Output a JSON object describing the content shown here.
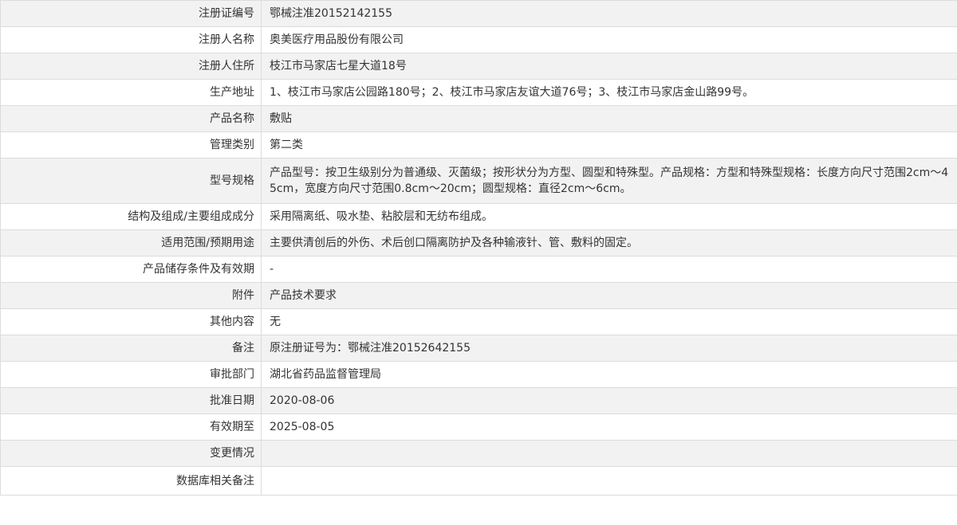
{
  "rows": [
    {
      "label": "注册证编号",
      "value": "鄂械注准20152142155"
    },
    {
      "label": "注册人名称",
      "value": "奥美医疗用品股份有限公司"
    },
    {
      "label": "注册人住所",
      "value": "枝江市马家店七星大道18号"
    },
    {
      "label": "生产地址",
      "value": "1、枝江市马家店公园路180号；2、枝江市马家店友谊大道76号；3、枝江市马家店金山路99号。"
    },
    {
      "label": "产品名称",
      "value": "敷贴"
    },
    {
      "label": "管理类别",
      "value": "第二类"
    },
    {
      "label": "型号规格",
      "value": "产品型号：按卫生级别分为普通级、灭菌级；按形状分为方型、圆型和特殊型。产品规格：方型和特殊型规格：长度方向尺寸范围2cm～45cm，宽度方向尺寸范围0.8cm～20cm；圆型规格：直径2cm～6cm。"
    },
    {
      "label": "结构及组成/主要组成成分",
      "value": "采用隔离纸、吸水垫、粘胶层和无纺布组成。"
    },
    {
      "label": "适用范围/预期用途",
      "value": "主要供清创后的外伤、术后创口隔离防护及各种输液针、管、敷料的固定。"
    },
    {
      "label": "产品储存条件及有效期",
      "value": "-"
    },
    {
      "label": "附件",
      "value": "产品技术要求"
    },
    {
      "label": "其他内容",
      "value": "无"
    },
    {
      "label": "备注",
      "value": "原注册证号为：鄂械注准20152642155"
    },
    {
      "label": "审批部门",
      "value": "湖北省药品监督管理局"
    },
    {
      "label": "批准日期",
      "value": "2020-08-06"
    },
    {
      "label": "有效期至",
      "value": "2025-08-05"
    },
    {
      "label": "变更情况",
      "value": ""
    },
    {
      "label": "数据库相关备注",
      "value": ""
    }
  ]
}
